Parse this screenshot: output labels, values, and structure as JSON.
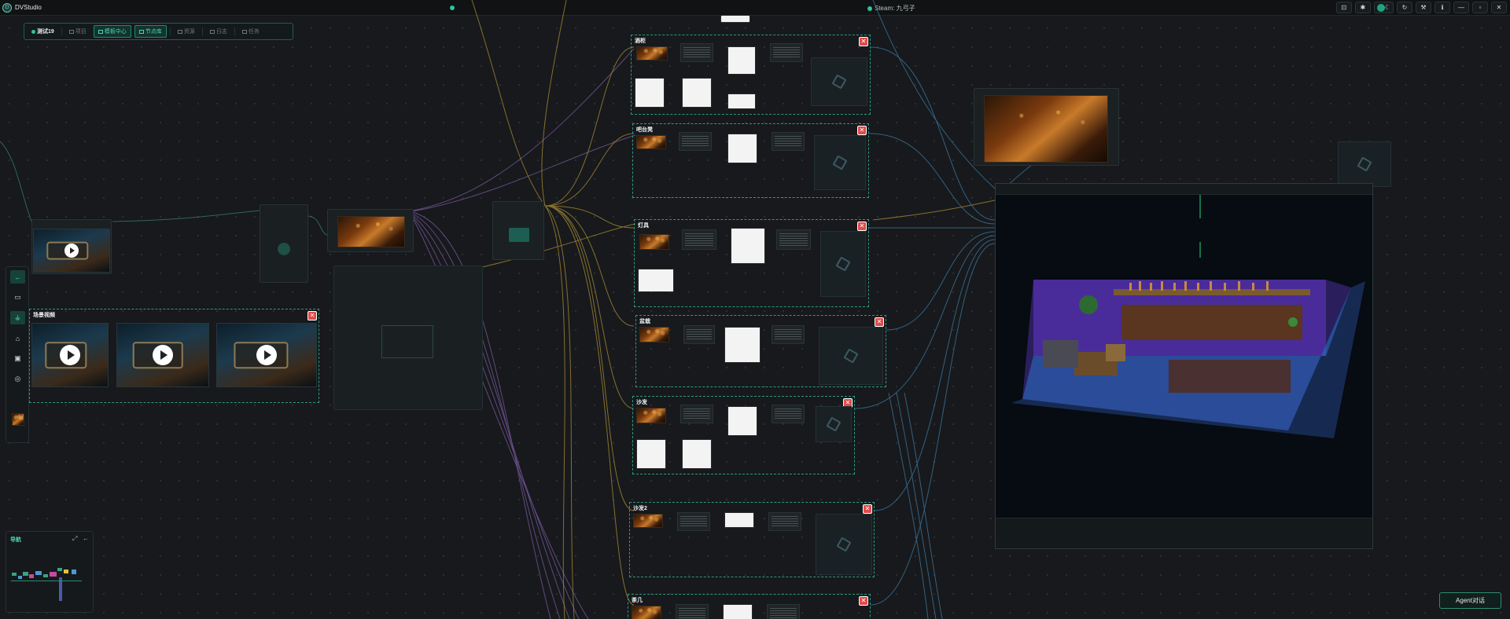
{
  "titlebar": {
    "app_name": "DVStudio",
    "logo_text": "D",
    "steam_label": "Steam: 九弓子"
  },
  "window_controls": [
    "⊡",
    "✱",
    "☾",
    "↻",
    "⚒",
    "ℹ",
    "—",
    "▫",
    "✕"
  ],
  "toolbar": {
    "project": "测试19",
    "items": [
      "项目",
      "模板中心",
      "节点库",
      "资源",
      "日志",
      "任务"
    ],
    "active_items": [
      1,
      2
    ]
  },
  "groups": {
    "g1": {
      "title": "酒柜"
    },
    "g2": {
      "title": "吧台凳"
    },
    "g3": {
      "title": "灯具"
    },
    "g4": {
      "title": "盆栽"
    },
    "g5": {
      "title": "沙发"
    },
    "g6": {
      "title": "沙发2"
    },
    "g7": {
      "title": "茶几"
    },
    "video_group": {
      "title": "场景视频"
    }
  },
  "close_glyph": "✕",
  "sidebar": {
    "icons": [
      "back-arrow-icon",
      "folder-icon",
      "flow-icon",
      "home-icon",
      "image-icon",
      "target-icon"
    ],
    "glyphs": [
      "←",
      "▭",
      "⚶",
      "⌂",
      "▣",
      "◎"
    ]
  },
  "navigator": {
    "title": "导航",
    "expand_glyph": "⤢",
    "back_glyph": "←"
  },
  "agent_button": {
    "label": "Agent对话"
  },
  "colors": {
    "accent": "#2ec3a1",
    "wire_yellow": "#c9a53a",
    "wire_purple": "#8a5fb0",
    "wire_blue": "#4e86b0",
    "close_red": "#e04b4b"
  }
}
